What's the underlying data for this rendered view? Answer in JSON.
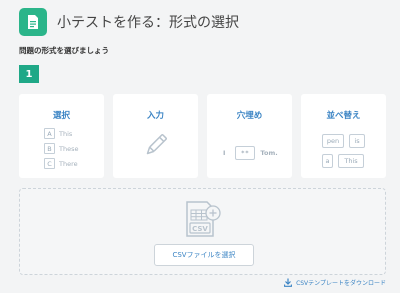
{
  "header": {
    "title": "小テストを作る：形式の選択"
  },
  "subhead": "問題の形式を選びましょう",
  "step": "1",
  "formats": [
    {
      "title": "選択",
      "options": [
        {
          "letter": "A",
          "text": "This"
        },
        {
          "letter": "B",
          "text": "These"
        },
        {
          "letter": "C",
          "text": "There"
        }
      ]
    },
    {
      "title": "入力"
    },
    {
      "title": "穴埋め",
      "prefix": "I",
      "blank": "**",
      "suffix": "Tom."
    },
    {
      "title": "並べ替え",
      "words": [
        "pen",
        "is",
        "a",
        "This"
      ]
    }
  ],
  "csv": {
    "icon_label": "CSV",
    "select_button": "CSVファイルを選択"
  },
  "download_link": "CSVテンプレートをダウンロード",
  "colors": {
    "accent_green": "#2bb58a",
    "step_green": "#1fa887",
    "link_blue": "#3b84c4"
  }
}
